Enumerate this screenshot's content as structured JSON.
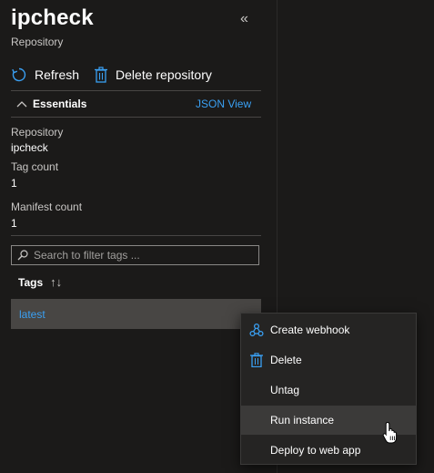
{
  "header": {
    "title": "ipcheck",
    "subtitle": "Repository",
    "collapse_glyph": "«"
  },
  "toolbar": {
    "refresh_label": "Refresh",
    "delete_label": "Delete repository"
  },
  "essentials": {
    "label": "Essentials",
    "json_view": "JSON View",
    "fields": [
      {
        "label": "Repository",
        "value": "ipcheck"
      },
      {
        "label": "Tag count",
        "value": "1"
      },
      {
        "label": "Manifest count",
        "value": "1"
      }
    ]
  },
  "search": {
    "placeholder": "Search to filter tags ..."
  },
  "tags": {
    "header": "Tags",
    "sort_glyph": "↑↓",
    "rows": [
      "latest"
    ]
  },
  "context_menu": {
    "items": [
      {
        "label": "Create webhook",
        "icon": "webhook-icon"
      },
      {
        "label": "Delete",
        "icon": "trash-icon"
      },
      {
        "label": "Untag",
        "icon": ""
      },
      {
        "label": "Run instance",
        "icon": "",
        "highlighted": true
      },
      {
        "label": "Deploy to web app",
        "icon": ""
      }
    ]
  },
  "colors": {
    "accent": "#3aa0f3",
    "background": "#1b1a19",
    "row_selected": "#484644",
    "menu_bg": "#252423"
  }
}
